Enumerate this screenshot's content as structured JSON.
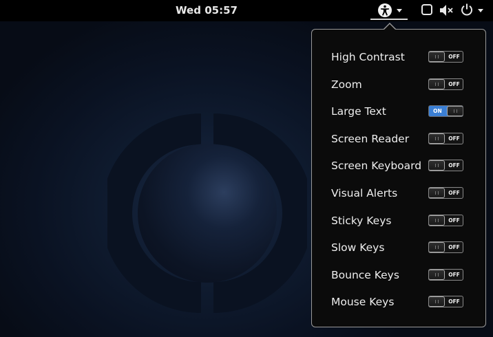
{
  "topbar": {
    "clock": "Wed 05:57"
  },
  "icons": {
    "accessibility": "accessibility-icon",
    "dropdown": "chevron-down-icon",
    "window": "window-icon",
    "volume": "volume-muted-icon",
    "power": "power-icon"
  },
  "colors": {
    "toggle_on": "#3b7fd4",
    "popover_bg": "#0b0b0b",
    "topbar_bg": "#000000"
  },
  "accessibility_menu": {
    "items": [
      {
        "label": "High Contrast",
        "state": "OFF",
        "enabled": false
      },
      {
        "label": "Zoom",
        "state": "OFF",
        "enabled": false
      },
      {
        "label": "Large Text",
        "state": "ON",
        "enabled": true
      },
      {
        "label": "Screen Reader",
        "state": "OFF",
        "enabled": false
      },
      {
        "label": "Screen Keyboard",
        "state": "OFF",
        "enabled": false
      },
      {
        "label": "Visual Alerts",
        "state": "OFF",
        "enabled": false
      },
      {
        "label": "Sticky Keys",
        "state": "OFF",
        "enabled": false
      },
      {
        "label": "Slow Keys",
        "state": "OFF",
        "enabled": false
      },
      {
        "label": "Bounce Keys",
        "state": "OFF",
        "enabled": false
      },
      {
        "label": "Mouse Keys",
        "state": "OFF",
        "enabled": false
      }
    ]
  }
}
